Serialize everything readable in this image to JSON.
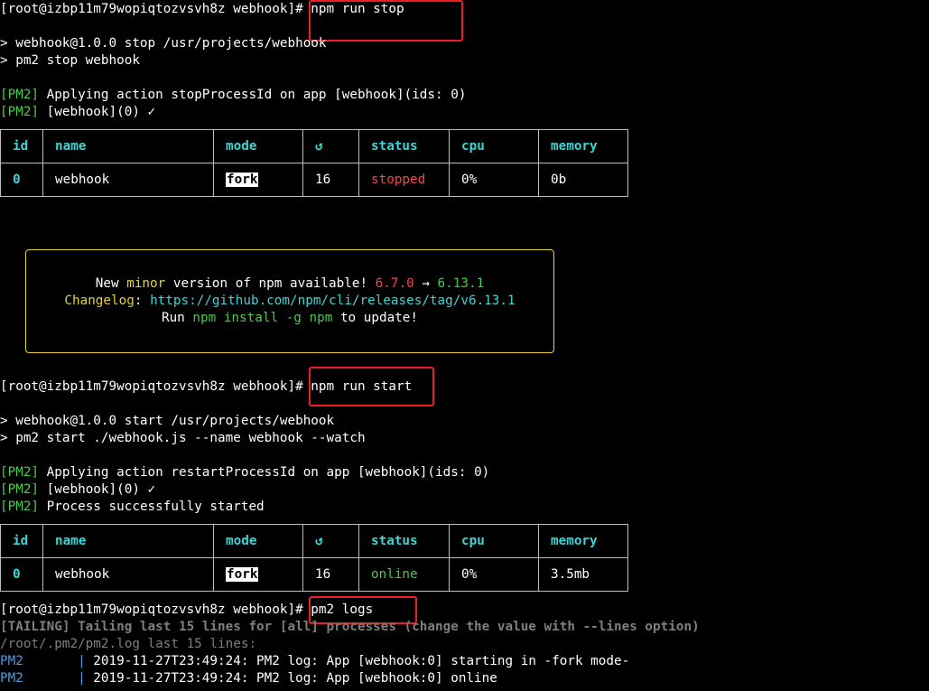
{
  "block1": {
    "prompt": "[root@izbp11m79wopiqtozvsvh8z webhook]",
    "prompt_symbol": "#",
    "command": " npm run stop",
    "script_line_1": "> webhook@1.0.0 stop /usr/projects/webhook",
    "script_line_2": "> pm2 stop webhook",
    "pm2_tag": "[PM2]",
    "log_1": " Applying action stopProcessId on app [webhook](ids: 0)",
    "log_2": " [webhook](0) ✓"
  },
  "table_headers": {
    "id": "id",
    "name": "name",
    "mode": "mode",
    "restarts": "↺",
    "status": "status",
    "cpu": "cpu",
    "memory": "memory"
  },
  "table1_row": {
    "id": "0",
    "name": "webhook",
    "mode": "fork",
    "restarts": "16",
    "status": "stopped",
    "cpu": "0%",
    "memory": "0b"
  },
  "notice": {
    "line1_a": "New ",
    "line1_b": "minor",
    "line1_c": " version of npm available! ",
    "line1_d": "6.7.0",
    "line1_e": " → ",
    "line1_f": "6.13.1",
    "line2_a": "Changelog",
    "line2_b": ": ",
    "line2_c": "https://github.com/npm/cli/releases/tag/v6.13.1",
    "line3_a": "Run ",
    "line3_b": "npm install -g npm",
    "line3_c": " to update!"
  },
  "block2": {
    "prompt": "[root@izbp11m79wopiqtozvsvh8z webhook]",
    "prompt_symbol": "#",
    "command": " npm run start",
    "script_line_1": "> webhook@1.0.0 start /usr/projects/webhook",
    "script_line_2": "> pm2 start ./webhook.js --name webhook --watch",
    "pm2_tag": "[PM2]",
    "log_1": " Applying action restartProcessId on app [webhook](ids: 0)",
    "log_2": " [webhook](0) ✓",
    "log_3": " Process successfully started"
  },
  "table2_row": {
    "id": "0",
    "name": "webhook",
    "mode": "fork",
    "restarts": "16",
    "status": "online",
    "cpu": "0%",
    "memory": "3.5mb"
  },
  "block3": {
    "prompt": "[root@izbp11m79wopiqtozvsvh8z webhook]",
    "prompt_symbol": "#",
    "command": " pm2 logs",
    "tailing": "[TAILING] Tailing last 15 lines for [all] processes (change the value with --lines option)",
    "logfile": "/root/.pm2/pm2.log last 15 lines:",
    "log_rows": [
      {
        "source": "PM2",
        "sep": "       | ",
        "text": "2019-11-27T23:49:24: PM2 log: App [webhook:0] starting in -fork mode-"
      },
      {
        "source": "PM2",
        "sep": "       | ",
        "text": "2019-11-27T23:49:24: PM2 log: App [webhook:0] online"
      }
    ]
  },
  "colors": {
    "background": "#000000",
    "pm2_green": "#4ec94e",
    "header_cyan": "#3fd5d5",
    "highlight_red": "#ee1c25",
    "stopped_red": "#f04848",
    "notice_yellow": "#e3d23a"
  }
}
